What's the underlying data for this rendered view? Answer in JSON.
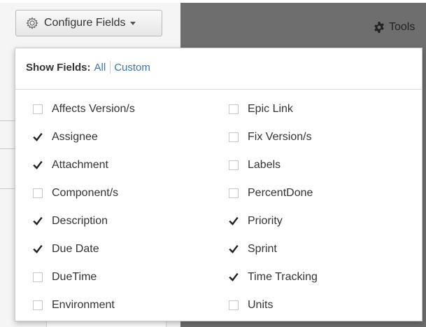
{
  "toolbar": {
    "configure_label": "Configure Fields",
    "tools_label": "Tools"
  },
  "dropdown": {
    "show_fields_label": "Show Fields:",
    "link_all": "All",
    "link_custom": "Custom",
    "left_fields": [
      {
        "label": "Affects Version/s",
        "checked": false
      },
      {
        "label": "Assignee",
        "checked": true
      },
      {
        "label": "Attachment",
        "checked": true
      },
      {
        "label": "Component/s",
        "checked": false
      },
      {
        "label": "Description",
        "checked": true
      },
      {
        "label": "Due Date",
        "checked": true
      },
      {
        "label": "DueTime",
        "checked": false
      },
      {
        "label": "Environment",
        "checked": false
      }
    ],
    "right_fields": [
      {
        "label": "Epic Link",
        "checked": false
      },
      {
        "label": "Fix Version/s",
        "checked": false
      },
      {
        "label": "Labels",
        "checked": false
      },
      {
        "label": "PercentDone",
        "checked": false
      },
      {
        "label": "Priority",
        "checked": true
      },
      {
        "label": "Sprint",
        "checked": true
      },
      {
        "label": "Time Tracking",
        "checked": true
      },
      {
        "label": "Units",
        "checked": false
      }
    ]
  },
  "colors": {
    "link": "#3b73af",
    "dark_background": "#6e6e6e"
  },
  "icons": {
    "configure": "gear-icon",
    "tools": "cog-icon",
    "checked": "checkmark-icon"
  }
}
